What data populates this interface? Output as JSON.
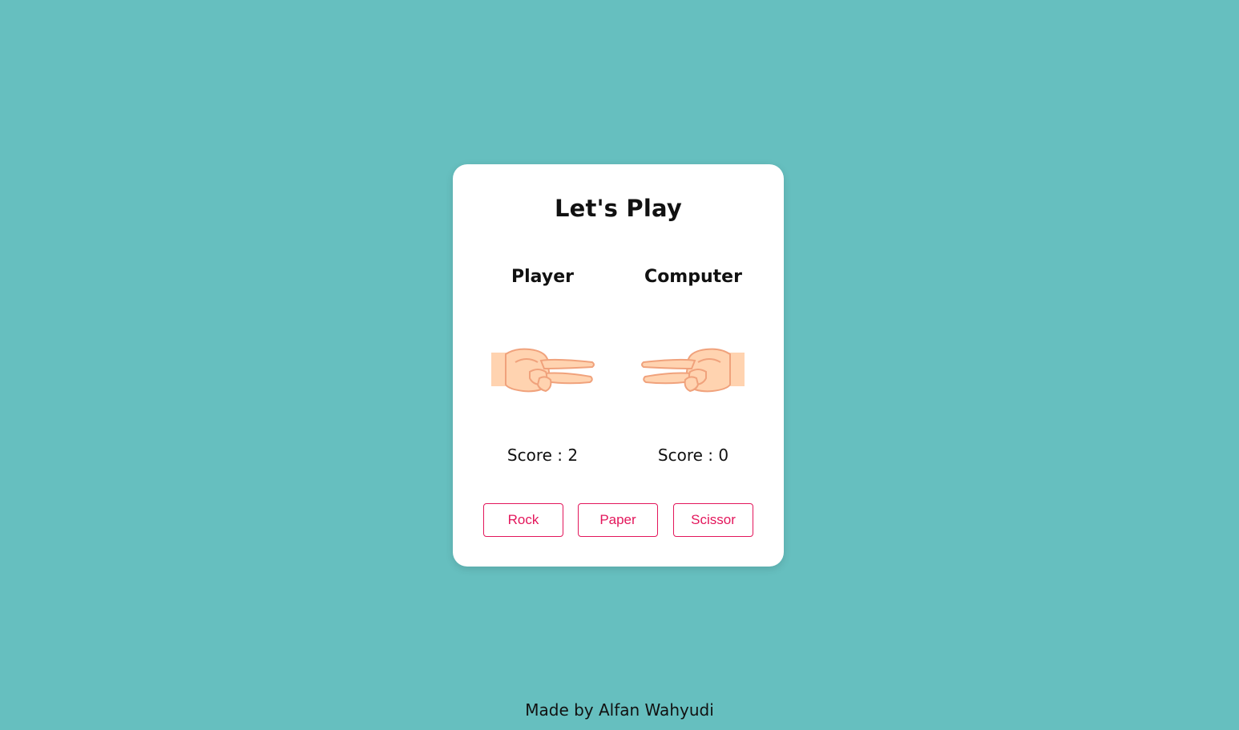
{
  "game": {
    "title": "Let's Play",
    "player": {
      "label": "Player",
      "score_text": "Score : 2",
      "hand_icon": "scissors-hand-icon"
    },
    "computer": {
      "label": "Computer",
      "score_text": "Score : 0",
      "hand_icon": "scissors-hand-icon"
    },
    "buttons": {
      "rock": "Rock",
      "paper": "Paper",
      "scissor": "Scissor"
    }
  },
  "footer": {
    "credit": "Made by Alfan Wahyudi"
  },
  "colors": {
    "background": "#66bfbf",
    "card": "#ffffff",
    "accent": "#e3165b",
    "skin": "#ffd3b0",
    "skin_outline": "#f0a27c"
  }
}
